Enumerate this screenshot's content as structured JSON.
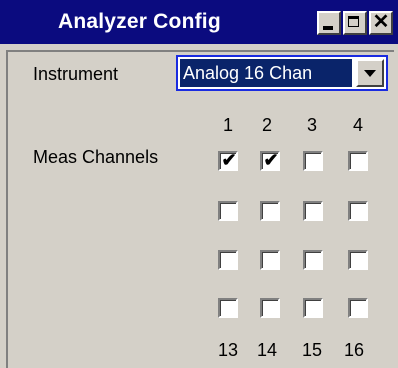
{
  "window": {
    "title": "Analyzer Config",
    "buttons": {
      "minimize": "minimize",
      "maximize": "maximize",
      "close": "✕"
    }
  },
  "instrument": {
    "label": "Instrument",
    "selected": "Analog 16 Chan"
  },
  "channels": {
    "label": "Meas Channels",
    "top_numbers": [
      "1",
      "2",
      "3",
      "4"
    ],
    "bottom_numbers": [
      "13",
      "14",
      "15",
      "16"
    ],
    "checked": [
      true,
      true,
      false,
      false,
      false,
      false,
      false,
      false,
      false,
      false,
      false,
      false,
      false,
      false,
      false,
      false
    ]
  },
  "colors": {
    "titlebar": "#0b0b7f",
    "selection": "#0a246a",
    "focus_border": "#1a2be0",
    "face": "#d4d0c8"
  }
}
